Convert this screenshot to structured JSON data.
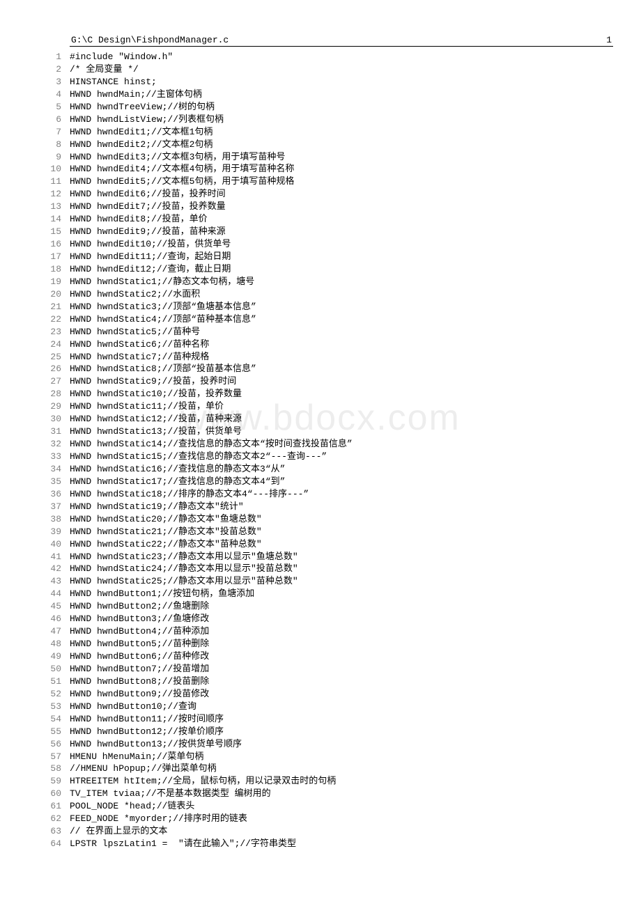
{
  "header": {
    "path": "G:\\C Design\\FishpondManager.c",
    "page_number": "1"
  },
  "watermark": "www.bdocx.com",
  "code_lines": [
    {
      "n": "1",
      "t": "#include \"Window.h\""
    },
    {
      "n": "2",
      "t": "/* 全局变量 */"
    },
    {
      "n": "3",
      "t": "HINSTANCE hinst;"
    },
    {
      "n": "4",
      "t": "HWND hwndMain;//主窗体句柄"
    },
    {
      "n": "5",
      "t": "HWND hwndTreeView;//树的句柄"
    },
    {
      "n": "6",
      "t": "HWND hwndListView;//列表框句柄"
    },
    {
      "n": "7",
      "t": "HWND hwndEdit1;//文本框1句柄"
    },
    {
      "n": "8",
      "t": "HWND hwndEdit2;//文本框2句柄"
    },
    {
      "n": "9",
      "t": "HWND hwndEdit3;//文本框3句柄，用于填写苗种号"
    },
    {
      "n": "10",
      "t": "HWND hwndEdit4;//文本框4句柄，用于填写苗种名称"
    },
    {
      "n": "11",
      "t": "HWND hwndEdit5;//文本框5句柄，用于填写苗种规格"
    },
    {
      "n": "12",
      "t": "HWND hwndEdit6;//投苗，投养时间"
    },
    {
      "n": "13",
      "t": "HWND hwndEdit7;//投苗，投养数量"
    },
    {
      "n": "14",
      "t": "HWND hwndEdit8;//投苗，单价"
    },
    {
      "n": "15",
      "t": "HWND hwndEdit9;//投苗，苗种来源"
    },
    {
      "n": "16",
      "t": "HWND hwndEdit10;//投苗，供货单号"
    },
    {
      "n": "17",
      "t": "HWND hwndEdit11;//查询，起始日期"
    },
    {
      "n": "18",
      "t": "HWND hwndEdit12;//查询，截止日期"
    },
    {
      "n": "19",
      "t": "HWND hwndStatic1;//静态文本句柄，塘号"
    },
    {
      "n": "20",
      "t": "HWND hwndStatic2;//水面积"
    },
    {
      "n": "21",
      "t": "HWND hwndStatic3;//顶部“鱼塘基本信息”"
    },
    {
      "n": "22",
      "t": "HWND hwndStatic4;//顶部“苗种基本信息”"
    },
    {
      "n": "23",
      "t": "HWND hwndStatic5;//苗种号"
    },
    {
      "n": "24",
      "t": "HWND hwndStatic6;//苗种名称"
    },
    {
      "n": "25",
      "t": "HWND hwndStatic7;//苗种规格"
    },
    {
      "n": "26",
      "t": "HWND hwndStatic8;//顶部“投苗基本信息”"
    },
    {
      "n": "27",
      "t": "HWND hwndStatic9;//投苗，投养时间"
    },
    {
      "n": "28",
      "t": "HWND hwndStatic10;//投苗，投养数量"
    },
    {
      "n": "29",
      "t": "HWND hwndStatic11;//投苗，单价"
    },
    {
      "n": "30",
      "t": "HWND hwndStatic12;//投苗，苗种来源"
    },
    {
      "n": "31",
      "t": "HWND hwndStatic13;//投苗，供货单号"
    },
    {
      "n": "32",
      "t": "HWND hwndStatic14;//查找信息的静态文本“按时间查找投苗信息”"
    },
    {
      "n": "33",
      "t": "HWND hwndStatic15;//查找信息的静态文本2“---查询---”"
    },
    {
      "n": "34",
      "t": "HWND hwndStatic16;//查找信息的静态文本3“从”"
    },
    {
      "n": "35",
      "t": "HWND hwndStatic17;//查找信息的静态文本4“到”"
    },
    {
      "n": "36",
      "t": "HWND hwndStatic18;//排序的静态文本4“---排序---”"
    },
    {
      "n": "37",
      "t": "HWND hwndStatic19;//静态文本\"统计\""
    },
    {
      "n": "38",
      "t": "HWND hwndStatic20;//静态文本\"鱼塘总数\""
    },
    {
      "n": "39",
      "t": "HWND hwndStatic21;//静态文本\"投苗总数\""
    },
    {
      "n": "40",
      "t": "HWND hwndStatic22;//静态文本\"苗种总数\""
    },
    {
      "n": "41",
      "t": "HWND hwndStatic23;//静态文本用以显示\"鱼塘总数\""
    },
    {
      "n": "42",
      "t": "HWND hwndStatic24;//静态文本用以显示\"投苗总数\""
    },
    {
      "n": "43",
      "t": "HWND hwndStatic25;//静态文本用以显示\"苗种总数\""
    },
    {
      "n": "44",
      "t": "HWND hwndButton1;//按钮句柄，鱼塘添加"
    },
    {
      "n": "45",
      "t": "HWND hwndButton2;//鱼塘删除"
    },
    {
      "n": "46",
      "t": "HWND hwndButton3;//鱼塘修改"
    },
    {
      "n": "47",
      "t": "HWND hwndButton4;//苗种添加"
    },
    {
      "n": "48",
      "t": "HWND hwndButton5;//苗种删除"
    },
    {
      "n": "49",
      "t": "HWND hwndButton6;//苗种修改"
    },
    {
      "n": "50",
      "t": "HWND hwndButton7;//投苗增加"
    },
    {
      "n": "51",
      "t": "HWND hwndButton8;//投苗删除"
    },
    {
      "n": "52",
      "t": "HWND hwndButton9;//投苗修改"
    },
    {
      "n": "53",
      "t": "HWND hwndButton10;//查询"
    },
    {
      "n": "54",
      "t": "HWND hwndButton11;//按时间顺序"
    },
    {
      "n": "55",
      "t": "HWND hwndButton12;//按单价顺序"
    },
    {
      "n": "56",
      "t": "HWND hwndButton13;//按供货单号顺序"
    },
    {
      "n": "57",
      "t": "HMENU hMenuMain;//菜单句柄"
    },
    {
      "n": "58",
      "t": "//HMENU hPopup;//弹出菜单句柄"
    },
    {
      "n": "59",
      "t": "HTREEITEM htItem;//全局，鼠标句柄，用以记录双击时的句柄"
    },
    {
      "n": "60",
      "t": "TV_ITEM tviaa;//不是基本数据类型 编树用的"
    },
    {
      "n": "61",
      "t": "POOL_NODE *head;//链表头"
    },
    {
      "n": "62",
      "t": "FEED_NODE *myorder;//排序时用的链表"
    },
    {
      "n": "63",
      "t": "// 在界面上显示的文本"
    },
    {
      "n": "64",
      "t": "LPSTR lpszLatin1 =  \"请在此输入\";//字符串类型"
    }
  ]
}
